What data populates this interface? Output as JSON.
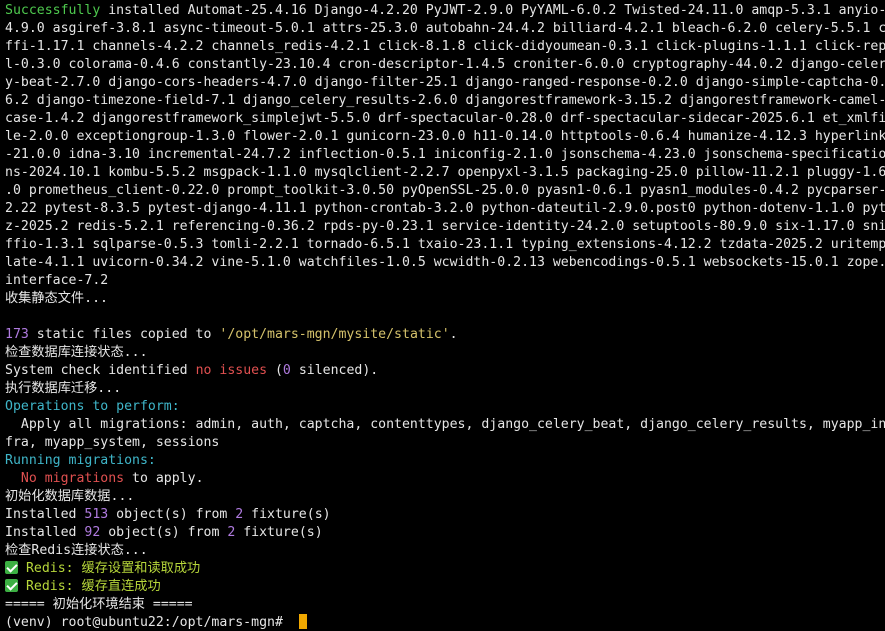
{
  "colors": {
    "background": "#000000",
    "text": "#e6e6e6",
    "success_green": "#4ec94e",
    "number_purple": "#b07be0",
    "string_yellow": "#d5c26b",
    "error_red": "#e05050",
    "header_cyan": "#3fb6c9",
    "redis_lime": "#b6d63a",
    "cursor_orange": "#f0a800"
  },
  "pip_install": {
    "success_word": "Successfully",
    "lines": [
      " installed Automat-25.4.16 Django-4.2.20 PyJWT-2.9.0 PyYAML-6.0.2 Twisted-24.11.0 amqp-5.3.1 anyio-",
      "4.9.0 asgiref-3.8.1 async-timeout-5.0.1 attrs-25.3.0 autobahn-24.4.2 billiard-4.2.1 bleach-6.2.0 celery-5.5.1 c",
      "ffi-1.17.1 channels-4.2.2 channels_redis-4.2.1 click-8.1.8 click-didyoumean-0.3.1 click-plugins-1.1.1 click-rep",
      "l-0.3.0 colorama-0.4.6 constantly-23.10.4 cron-descriptor-1.4.5 croniter-6.0.0 cryptography-44.0.2 django-celer",
      "y-beat-2.7.0 django-cors-headers-4.7.0 django-filter-25.1 django-ranged-response-0.2.0 django-simple-captcha-0.",
      "6.2 django-timezone-field-7.1 django_celery_results-2.6.0 djangorestframework-3.15.2 djangorestframework-camel-",
      "case-1.4.2 djangorestframework_simplejwt-5.5.0 drf-spectacular-0.28.0 drf-spectacular-sidecar-2025.6.1 et_xmlfi",
      "le-2.0.0 exceptiongroup-1.3.0 flower-2.0.1 gunicorn-23.0.0 h11-0.14.0 httptools-0.6.4 humanize-4.12.3 hyperlink",
      "-21.0.0 idna-3.10 incremental-24.7.2 inflection-0.5.1 iniconfig-2.1.0 jsonschema-4.23.0 jsonschema-specificatio",
      "ns-2024.10.1 kombu-5.5.2 msgpack-1.1.0 mysqlclient-2.2.7 openpyxl-3.1.5 packaging-25.0 pillow-11.2.1 pluggy-1.6",
      ".0 prometheus_client-0.22.0 prompt_toolkit-3.0.50 pyOpenSSL-25.0.0 pyasn1-0.6.1 pyasn1_modules-0.4.2 pycparser-",
      "2.22 pytest-8.3.5 pytest-django-4.11.1 python-crontab-3.2.0 python-dateutil-2.9.0.post0 python-dotenv-1.1.0 pyt",
      "z-2025.2 redis-5.2.1 referencing-0.36.2 rpds-py-0.23.1 service-identity-24.2.0 setuptools-80.9.0 six-1.17.0 sni",
      "ffio-1.3.1 sqlparse-0.5.3 tomli-2.2.1 tornado-6.5.1 txaio-23.1.1 typing_extensions-4.12.2 tzdata-2025.2 uritemp",
      "late-4.1.1 uvicorn-0.34.2 vine-5.1.0 watchfiles-1.0.5 wcwidth-0.2.13 webencodings-0.5.1 websockets-15.0.1 zope.",
      "interface-7.2"
    ]
  },
  "collect_static": {
    "heading": "收集静态文件...",
    "count": "173",
    "text_before_path": " static files copied to ",
    "path": "'/opt/mars-mgn/mysite/static'",
    "text_after_path": "."
  },
  "db_check": {
    "heading": "检查数据库连接状态...",
    "prefix": "System check identified ",
    "issues": "no issues",
    "open_paren": " (",
    "silenced_count": "0",
    "suffix": " silenced)."
  },
  "migrate": {
    "heading": "执行数据库迁移...",
    "operations_label": "Operations to perform:",
    "apply_line_1": "  Apply all migrations: admin, auth, captcha, contenttypes, django_celery_beat, django_celery_results, myapp_in",
    "apply_line_2": "fra, myapp_system, sessions",
    "running_label": "Running migrations:",
    "no_migrations_indent": "  ",
    "no_migrations": "No migrations",
    "to_apply": " to apply."
  },
  "init_data": {
    "heading": "初始化数据库数据...",
    "fixtures": [
      {
        "installed": "Installed ",
        "count": "513",
        "object_text": " object(s) from ",
        "fixture_count": "2",
        "fixture_text": " fixture(s)"
      },
      {
        "installed": "Installed ",
        "count": "92",
        "object_text": " object(s) from ",
        "fixture_count": "2",
        "fixture_text": " fixture(s)"
      }
    ]
  },
  "redis_check": {
    "heading": "检查Redis连接状态...",
    "checks": [
      {
        "icon": "white-check-mark-icon",
        "text": " Redis: 缓存设置和读取成功"
      },
      {
        "icon": "white-check-mark-icon",
        "text": " Redis: 缓存直连成功"
      }
    ]
  },
  "footer": "===== 初始化环境结束 =====",
  "prompt": {
    "text": "(venv) root@ubuntu22:/opt/mars-mgn# "
  }
}
